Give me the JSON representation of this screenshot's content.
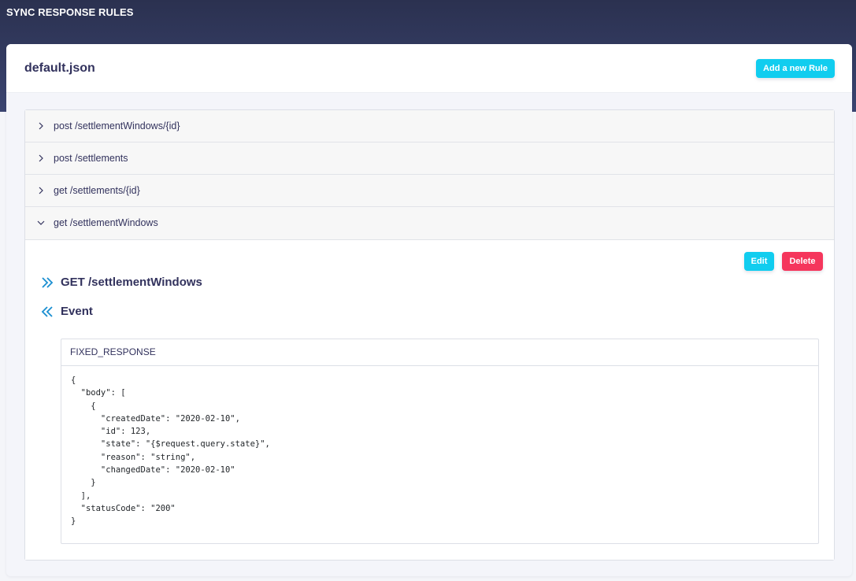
{
  "page": {
    "title": "SYNC RESPONSE RULES"
  },
  "card": {
    "title": "default.json",
    "add_button": "Add a new Rule"
  },
  "rules": [
    {
      "label": "post /settlementWindows/{id}",
      "expanded": false
    },
    {
      "label": "post /settlements",
      "expanded": false
    },
    {
      "label": "get /settlements/{id}",
      "expanded": false
    },
    {
      "label": "get /settlementWindows",
      "expanded": true
    }
  ],
  "expanded_rule": {
    "edit_button": "Edit",
    "delete_button": "Delete",
    "request_heading": "GET /settlementWindows",
    "event_heading": "Event",
    "response_type": "FIXED_RESPONSE",
    "response_body": "{\n  \"body\": [\n    {\n      \"createdDate\": \"2020-02-10\",\n      \"id\": 123,\n      \"state\": \"{$request.query.state}\",\n      \"reason\": \"string\",\n      \"changedDate\": \"2020-02-10\"\n    }\n  ],\n  \"statusCode\": \"200\"\n}"
  },
  "icons": {
    "collapsed": "chevron-right-icon",
    "expanded": "chevron-down-icon",
    "request": "double-chevron-right-icon",
    "event": "double-chevron-left-icon"
  },
  "colors": {
    "header_band": "#2b3150",
    "primary": "#11cdef",
    "danger": "#f5365c",
    "text": "#32325d",
    "accent_icon": "#1a8ed1"
  }
}
